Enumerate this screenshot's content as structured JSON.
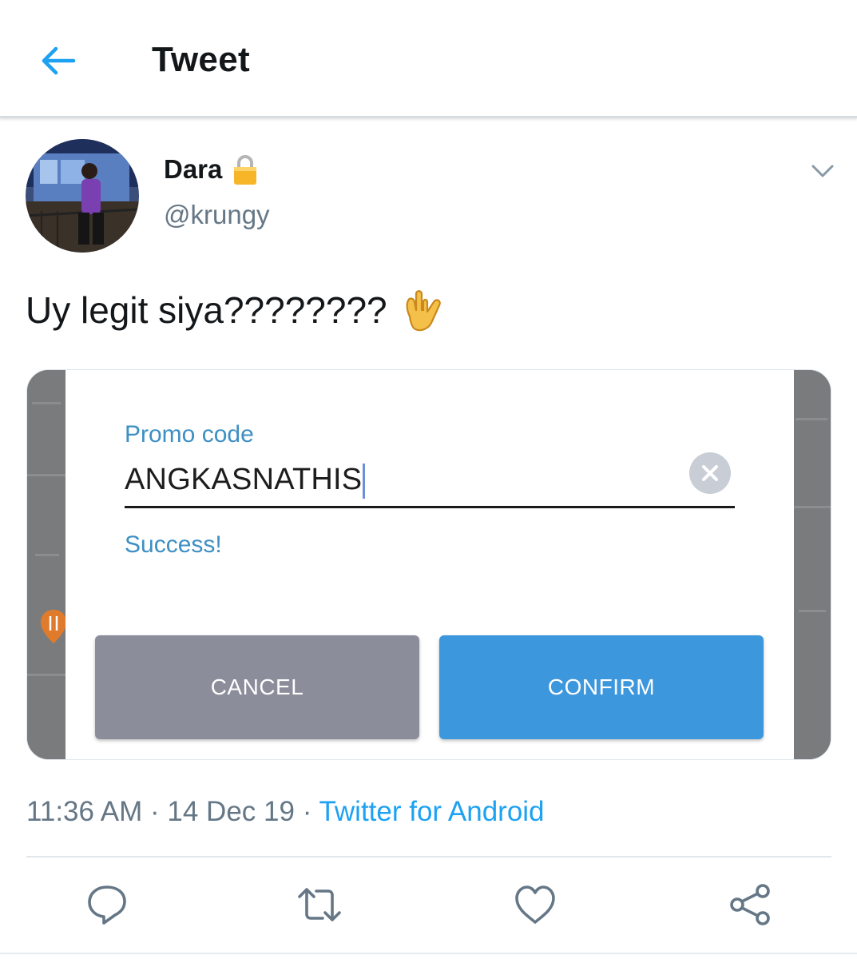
{
  "header": {
    "back_icon": "arrow-left-icon",
    "title": "Tweet"
  },
  "tweet": {
    "author": {
      "name": "Dara",
      "handle": "@krungy",
      "protected_icon": "lock-icon",
      "avatar": "avatar-photo"
    },
    "menu_icon": "chevron-down-icon",
    "text": "Uy legit siya????????",
    "emoji": "love-you-gesture-emoji",
    "media": {
      "promo_label": "Promo code",
      "promo_value": "ANGKASNATHIS",
      "clear_icon": "clear-circle-icon",
      "status_text": "Success!",
      "cancel_label": "CANCEL",
      "confirm_label": "CONFIRM",
      "accent_color": "#3d97dd"
    },
    "time": "11:36 AM",
    "separator": "·",
    "date": "14 Dec 19",
    "source": "Twitter for Android",
    "actions": [
      "reply-icon",
      "retweet-icon",
      "like-icon",
      "share-icon"
    ]
  },
  "colors": {
    "link": "#1da1f2",
    "secondary_text": "#657786",
    "primary_text": "#14171a"
  }
}
